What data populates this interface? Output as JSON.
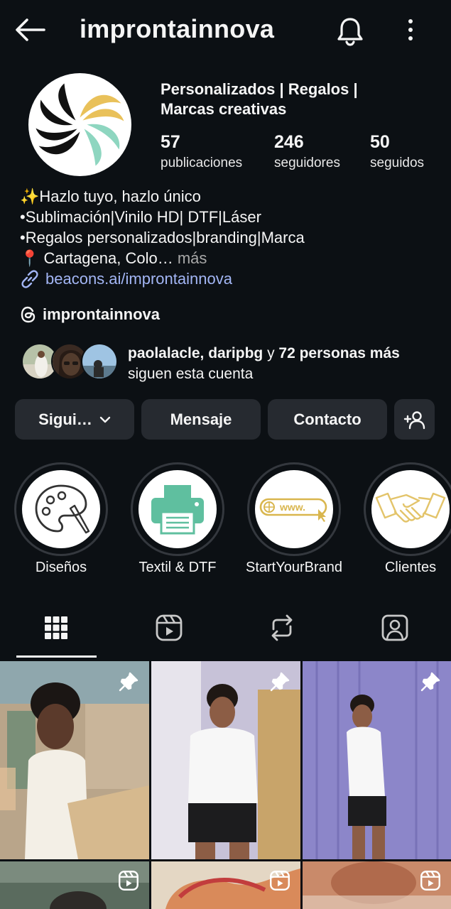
{
  "header": {
    "username": "improntainnova",
    "back_icon": "arrow-left-icon",
    "notifications_icon": "bell-icon",
    "more_icon": "more-vertical-icon"
  },
  "profile": {
    "display_name": "Personalizados | Regalos | Marcas creativas",
    "stats": [
      {
        "value": "57",
        "label": "publicaciones"
      },
      {
        "value": "246",
        "label": "seguidores"
      },
      {
        "value": "50",
        "label": "seguidos"
      }
    ],
    "bio": [
      "✨Hazlo tuyo, hazlo único",
      "•Sublimación|Vinilo HD| DTF|Láser",
      "•Regalos personalizados|branding|Marca",
      "📍 Cartagena, Colo…"
    ],
    "bio_more": "más",
    "link": "beacons.ai/improntainnova",
    "threads_handle": "improntainnova",
    "followed_by": {
      "names": "paolalacle, daripbg",
      "connector": " y ",
      "others": "72 personas más",
      "suffix": " siguen esta cuenta"
    }
  },
  "actions": {
    "follow": "Sigui…",
    "message": "Mensaje",
    "contact": "Contacto"
  },
  "highlights": [
    {
      "label": "Diseños",
      "icon": "palette-icon"
    },
    {
      "label": "Textil & DTF",
      "icon": "printer-icon"
    },
    {
      "label": "StartYourBrand",
      "icon": "www-cursor-icon"
    },
    {
      "label": "Clientes",
      "icon": "handshake-icon"
    }
  ],
  "tabs": [
    {
      "name": "grid",
      "icon": "grid-icon"
    },
    {
      "name": "reels",
      "icon": "reels-icon"
    },
    {
      "name": "reposts",
      "icon": "repost-icon"
    },
    {
      "name": "tagged",
      "icon": "tagged-person-icon"
    }
  ],
  "colors": {
    "background": "#0c1014",
    "button": "#262a30",
    "link": "#a3b6f5",
    "secondary_text": "#a8a8a8",
    "logo_yellow": "#e9c15a",
    "logo_teal": "#8ed6c0",
    "printer_green": "#5fbf9f",
    "handshake_gold": "#e3c46a"
  }
}
